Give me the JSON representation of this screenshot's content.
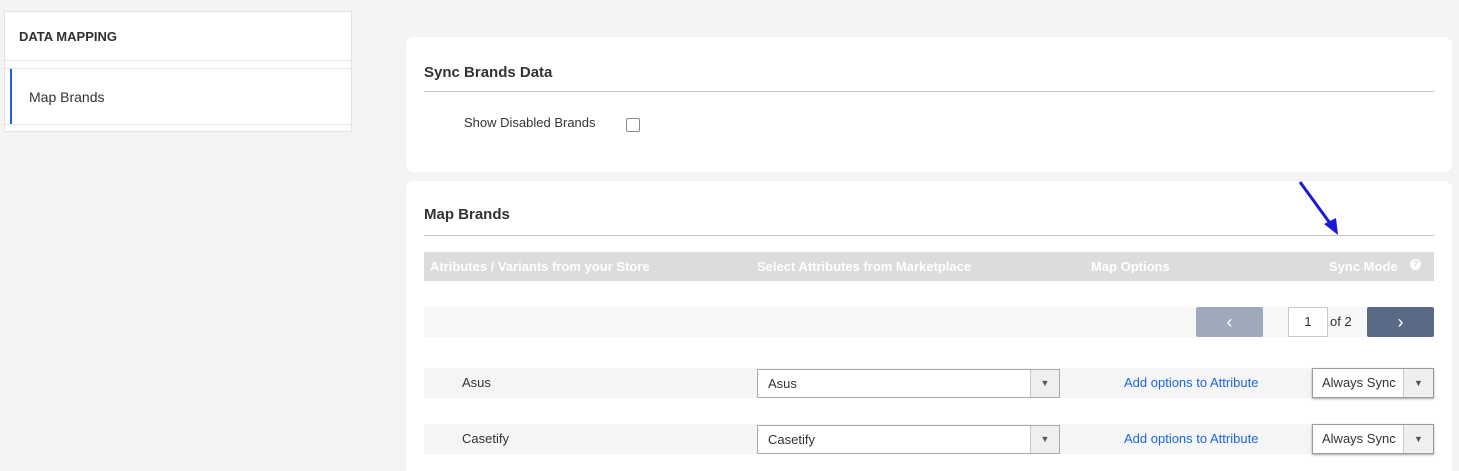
{
  "sidebar": {
    "header": "DATA MAPPING",
    "items": [
      {
        "label": "Map Brands"
      }
    ]
  },
  "sync_card": {
    "title": "Sync Brands Data",
    "show_disabled_label": "Show Disabled Brands",
    "show_disabled_checked": false
  },
  "map_card": {
    "title": "Map Brands",
    "columns": {
      "store": "Atributes / Variants from your Store",
      "marketplace": "Select Attributes from Marketplace",
      "options": "Map Options",
      "sync": "Sync Mode",
      "sync_help": "?"
    },
    "pagination": {
      "prev_icon": "‹",
      "page": "1",
      "of_label": "of 2",
      "next_icon": "›"
    },
    "rows": [
      {
        "brand": "Asus",
        "marketplace_value": "Asus",
        "link": "Add options to Attribute",
        "sync_mode": "Always Sync"
      },
      {
        "brand": "Casetify",
        "marketplace_value": "Casetify",
        "link": "Add options to Attribute",
        "sync_mode": "Always Sync"
      }
    ]
  },
  "colors": {
    "accent": "#1a66d9",
    "annotation_arrow": "#1a1adb",
    "table_header": "#dcdcdc",
    "next_button": "#5a6a85",
    "prev_button": "#9fa9bb"
  }
}
